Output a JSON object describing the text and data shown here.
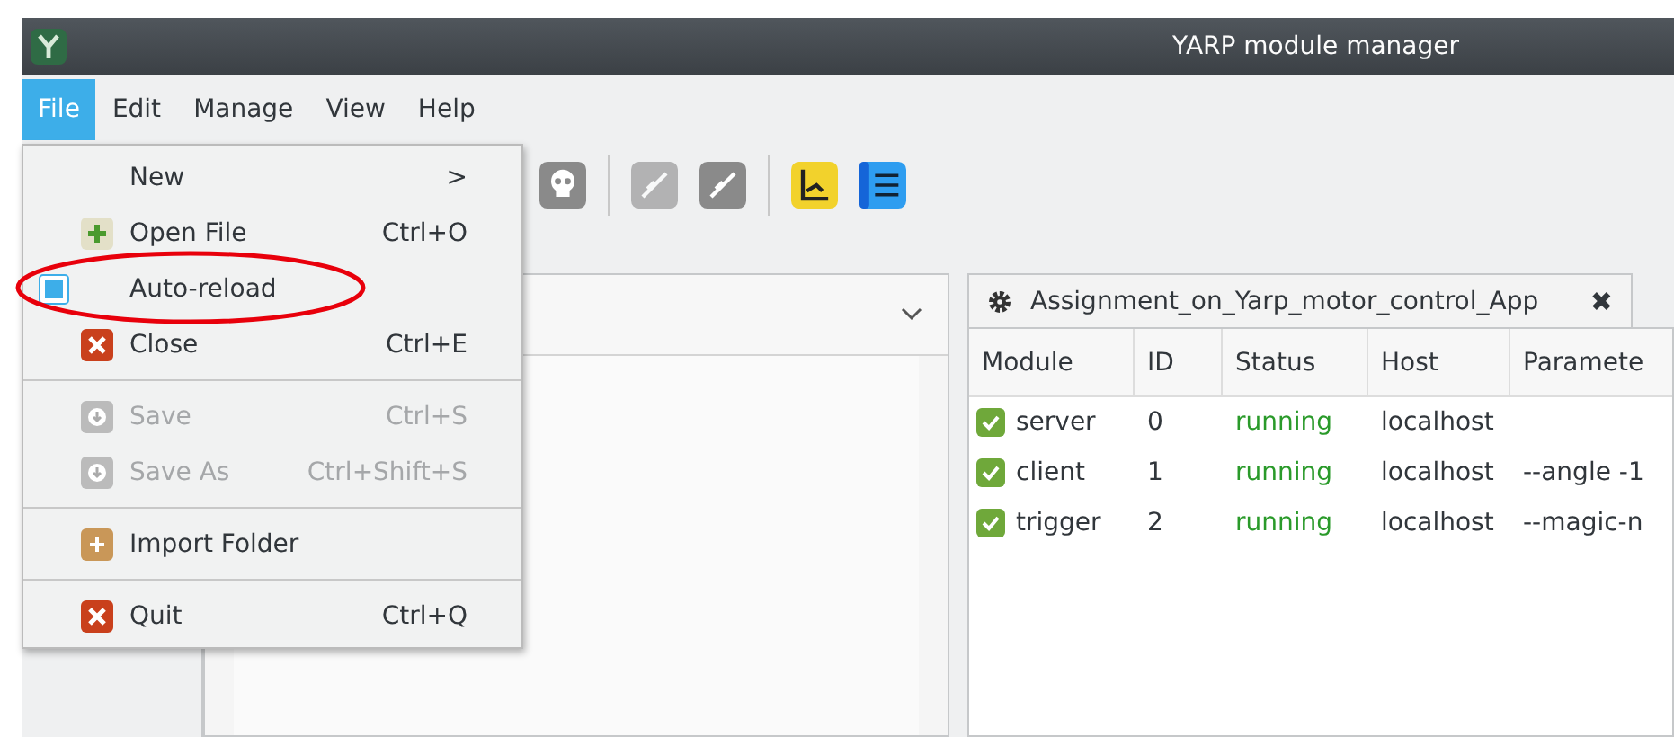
{
  "window": {
    "title": "YARP module manager"
  },
  "menubar": [
    {
      "label": "File",
      "selected": true
    },
    {
      "label": "Edit",
      "selected": false
    },
    {
      "label": "Manage",
      "selected": false
    },
    {
      "label": "View",
      "selected": false
    },
    {
      "label": "Help",
      "selected": false
    }
  ],
  "file_menu": [
    {
      "kind": "submenu",
      "label": "New",
      "arrow": ">",
      "disabled": false
    },
    {
      "kind": "open",
      "label": "Open File",
      "shortcut": "Ctrl+O",
      "disabled": false
    },
    {
      "kind": "checkbox",
      "label": "Auto-reload",
      "checked": true,
      "disabled": false,
      "annotated": true
    },
    {
      "kind": "close",
      "label": "Close",
      "shortcut": "Ctrl+E",
      "disabled": false
    },
    {
      "kind": "separator"
    },
    {
      "kind": "save",
      "label": "Save",
      "shortcut": "Ctrl+S",
      "disabled": true
    },
    {
      "kind": "save",
      "label": "Save As",
      "shortcut": "Ctrl+Shift+S",
      "disabled": true
    },
    {
      "kind": "separator"
    },
    {
      "kind": "import",
      "label": "Import Folder",
      "disabled": false
    },
    {
      "kind": "separator"
    },
    {
      "kind": "close",
      "label": "Quit",
      "shortcut": "Ctrl+Q",
      "disabled": false
    }
  ],
  "toolbar": [
    {
      "kind": "skull",
      "disabled": false
    },
    {
      "kind": "separator"
    },
    {
      "kind": "plug",
      "disabled": true
    },
    {
      "kind": "plug",
      "disabled": false
    },
    {
      "kind": "separator"
    },
    {
      "kind": "yellow",
      "disabled": false
    },
    {
      "kind": "list",
      "disabled": false
    }
  ],
  "tab": {
    "title": "Assignment_on_Yarp_motor_control_App",
    "close": "✖"
  },
  "table": {
    "columns": [
      "Module",
      "ID",
      "Status",
      "Host",
      "Paramete"
    ],
    "rows": [
      {
        "checked": true,
        "module": "server",
        "id": "0",
        "status": "running",
        "host": "localhost",
        "parameters": ""
      },
      {
        "checked": true,
        "module": "client",
        "id": "1",
        "status": "running",
        "host": "localhost",
        "parameters": "--angle -1"
      },
      {
        "checked": true,
        "module": "trigger",
        "id": "2",
        "status": "running",
        "host": "localhost",
        "parameters": "--magic-n"
      }
    ]
  }
}
